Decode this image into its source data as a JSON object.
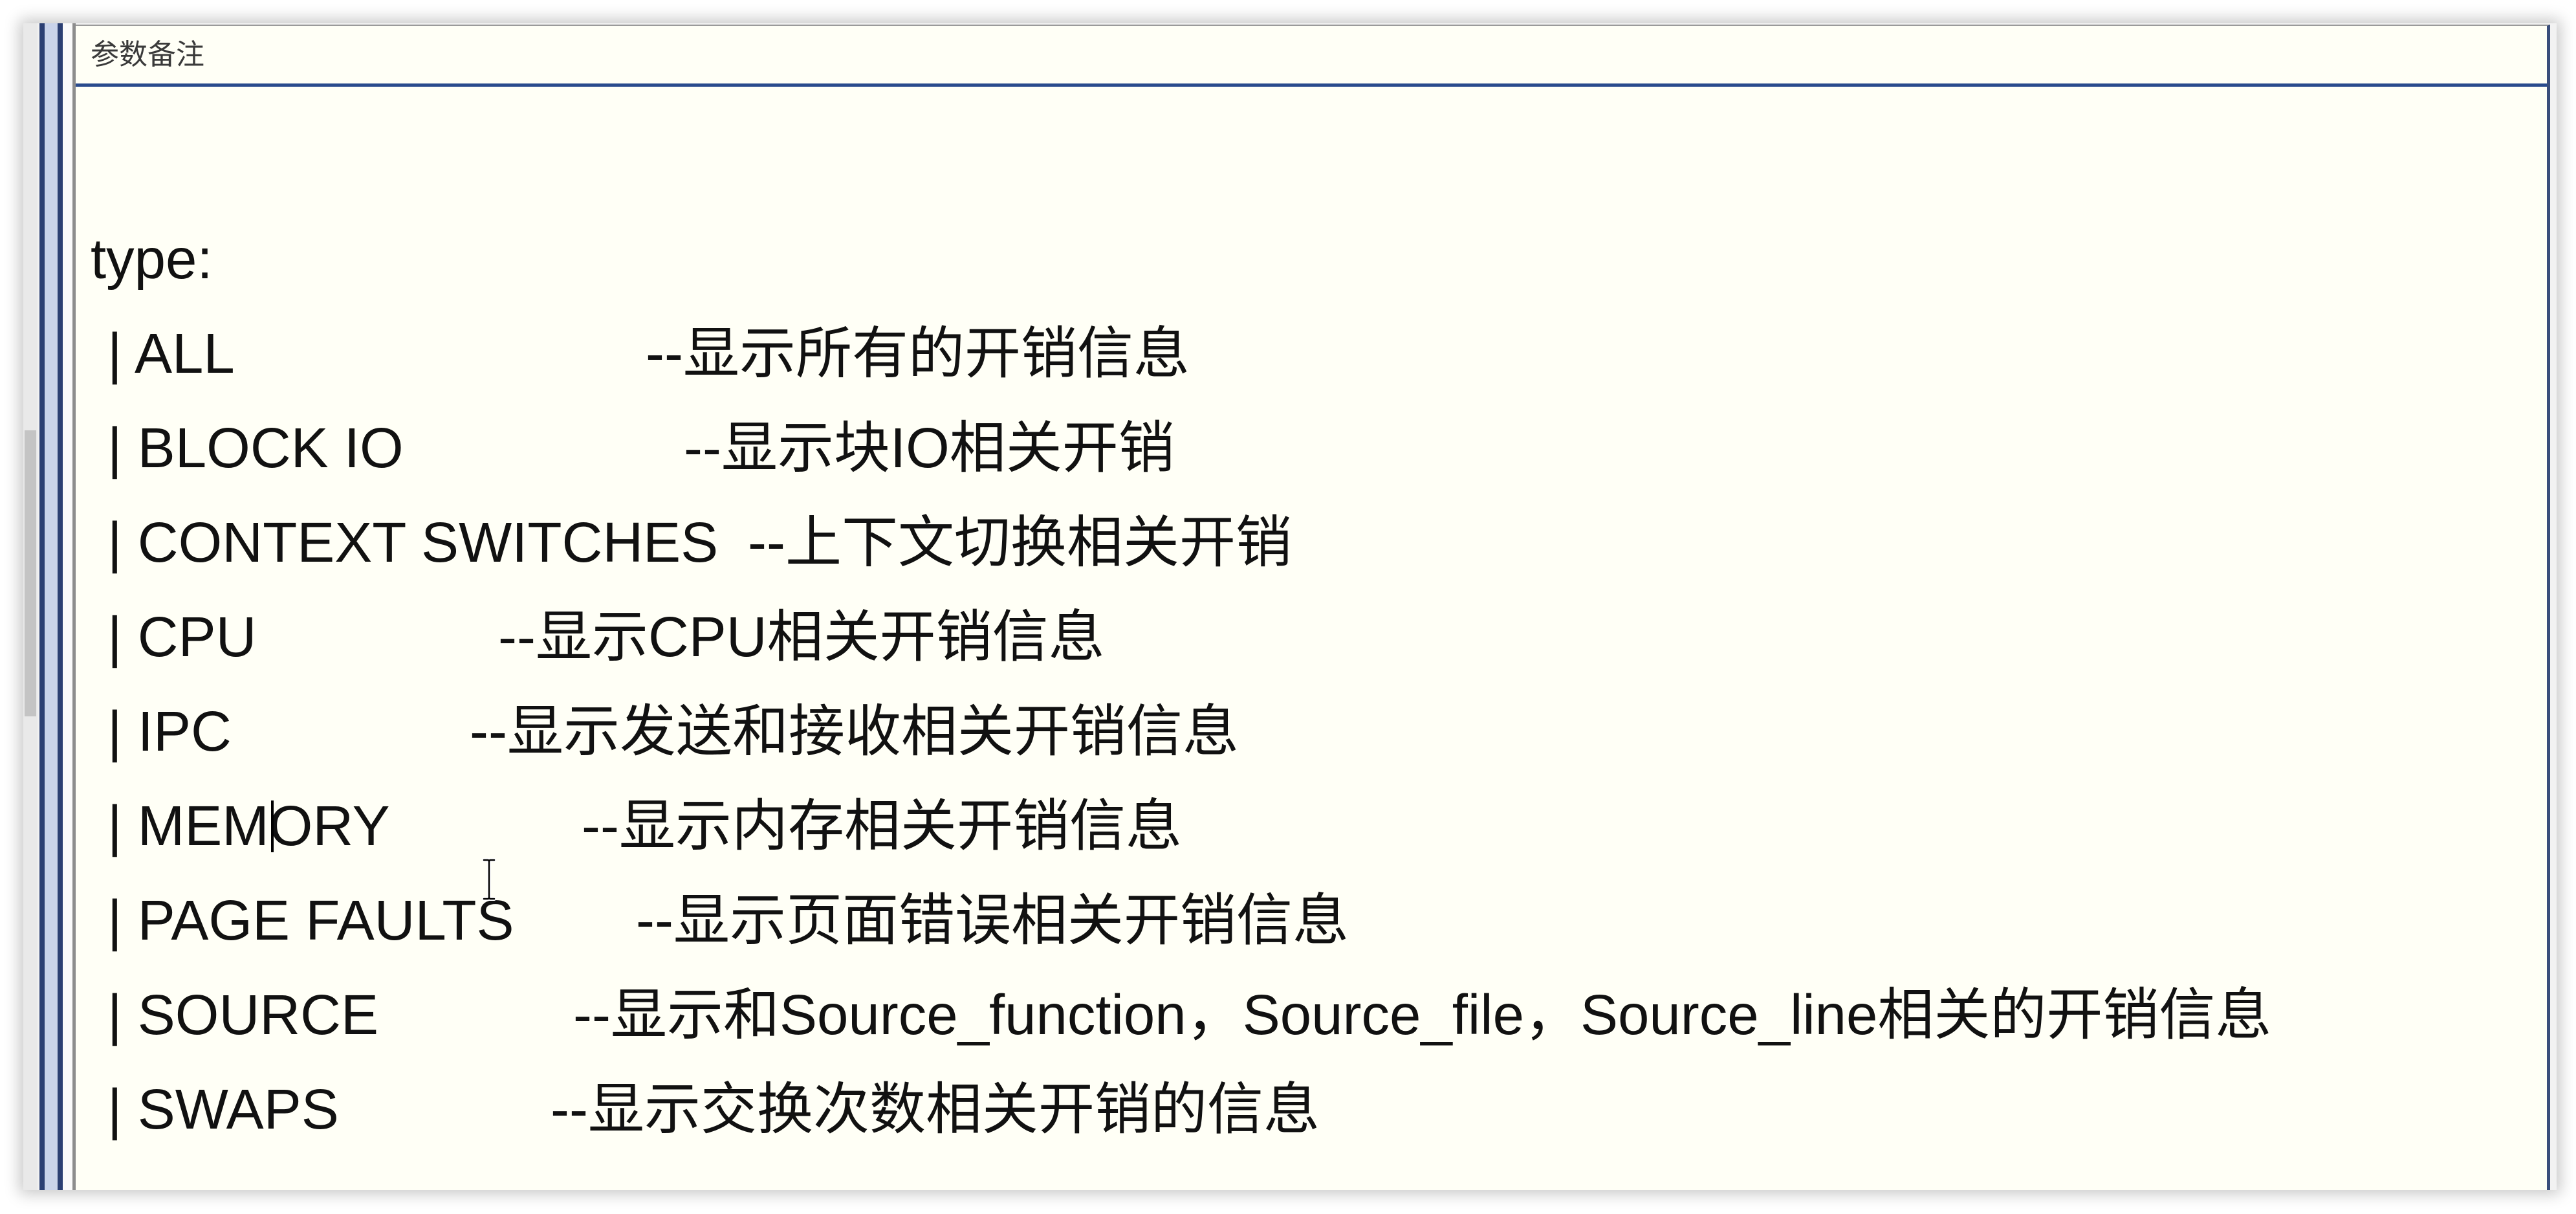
{
  "header": {
    "title": "参数备注"
  },
  "editor": {
    "heading": "type:",
    "rows": [
      {
        "option": "| ALL",
        "description": "--显示所有的开销信息"
      },
      {
        "option": "| BLOCK IO",
        "description": "--显示块IO相关开销"
      },
      {
        "option": "| CONTEXT SWITCHES",
        "description": "--上下文切换相关开销"
      },
      {
        "option": "| CPU",
        "description": "--显示CPU相关开销信息"
      },
      {
        "option": "| IPC",
        "description": "--显示发送和接收相关开销信息"
      },
      {
        "option": "| MEMORY",
        "description": "--显示内存相关开销信息"
      },
      {
        "option": "| PAGE FAULTS",
        "description": "--显示页面错误相关开销信息"
      },
      {
        "option": "| SOURCE",
        "description": "--显示和Source_function，Source_file，Source_line相关的开销信息"
      },
      {
        "option": "| SWAPS",
        "description": "--显示交换次数相关开销的信息"
      }
    ]
  },
  "icons": {
    "mouse_cursor": "ibeam-cursor-icon"
  },
  "colors": {
    "editor_background": "#fffff6",
    "accent_border": "#2a4b8d",
    "text": "#111111"
  }
}
